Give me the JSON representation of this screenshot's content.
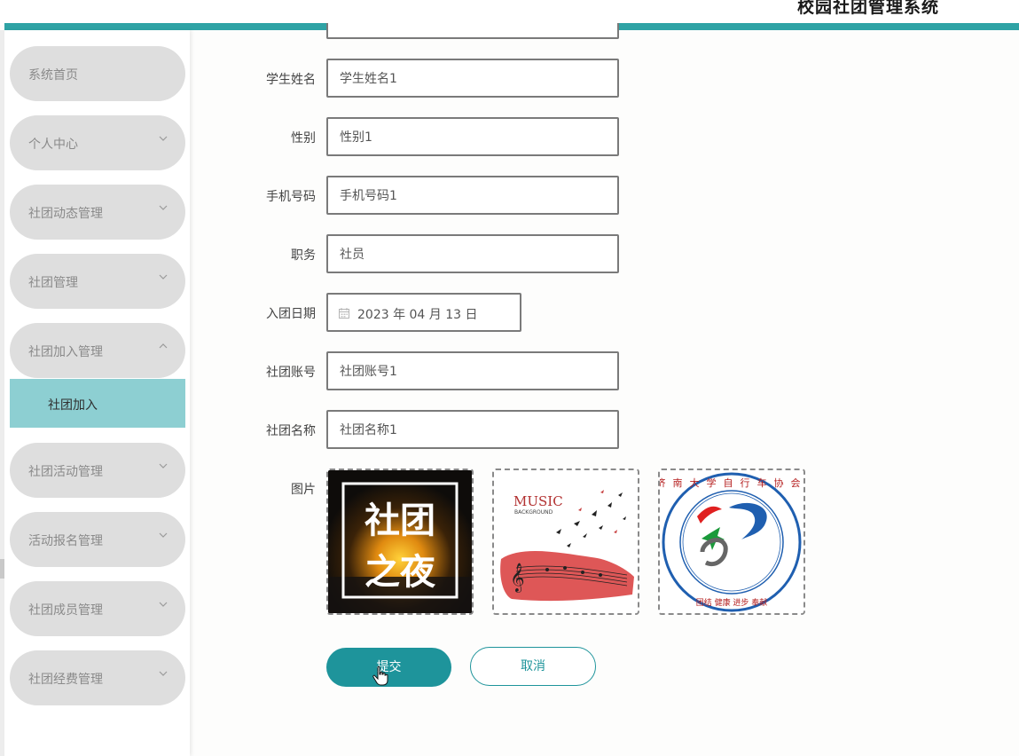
{
  "header": {
    "title": "校园社团管理系统"
  },
  "sidebar": {
    "items": [
      {
        "label": "系统首页",
        "chevron": "none"
      },
      {
        "label": "个人中心",
        "chevron": "chevron-down"
      },
      {
        "label": "社团动态管理",
        "chevron": "chevron-down"
      },
      {
        "label": "社团管理",
        "chevron": "chevron-down"
      },
      {
        "label": "社团加入管理",
        "chevron": "chevron-up"
      },
      {
        "label": "社团活动管理",
        "chevron": "chevron-down"
      },
      {
        "label": "活动报名管理",
        "chevron": "chevron-down"
      },
      {
        "label": "社团成员管理",
        "chevron": "chevron-down"
      },
      {
        "label": "社团经费管理",
        "chevron": "chevron-down"
      }
    ],
    "active_sub_item": {
      "label": "社团加入"
    }
  },
  "form": {
    "student_name": {
      "label": "学生姓名",
      "value": "学生姓名1"
    },
    "gender": {
      "label": "性别",
      "value": "性别1"
    },
    "phone": {
      "label": "手机号码",
      "value": "手机号码1"
    },
    "position": {
      "label": "职务",
      "value": "社员"
    },
    "join_date": {
      "label": "入团日期",
      "value": "2023 年 04 月 13 日"
    },
    "club_account": {
      "label": "社团账号",
      "value": "社团账号1"
    },
    "club_name": {
      "label": "社团名称",
      "value": "社团名称1"
    },
    "images": {
      "label": "图片",
      "items": [
        {
          "caption_line1": "社团",
          "caption_line2": "之夜"
        },
        {
          "title": "MUSIC",
          "subtitle": "BACKGROUND"
        },
        {
          "emblem_text": "济南大学自行车协会",
          "bottom_text": "团结 健康 进步 奉献"
        }
      ]
    },
    "submit_label": "提交",
    "cancel_label": "取消"
  },
  "colors": {
    "accent": "#1e949b",
    "header_stripe": "#2fa3a5",
    "nav_item_bg": "#dedede",
    "nav_active_sub_bg": "#8dcfd2"
  }
}
